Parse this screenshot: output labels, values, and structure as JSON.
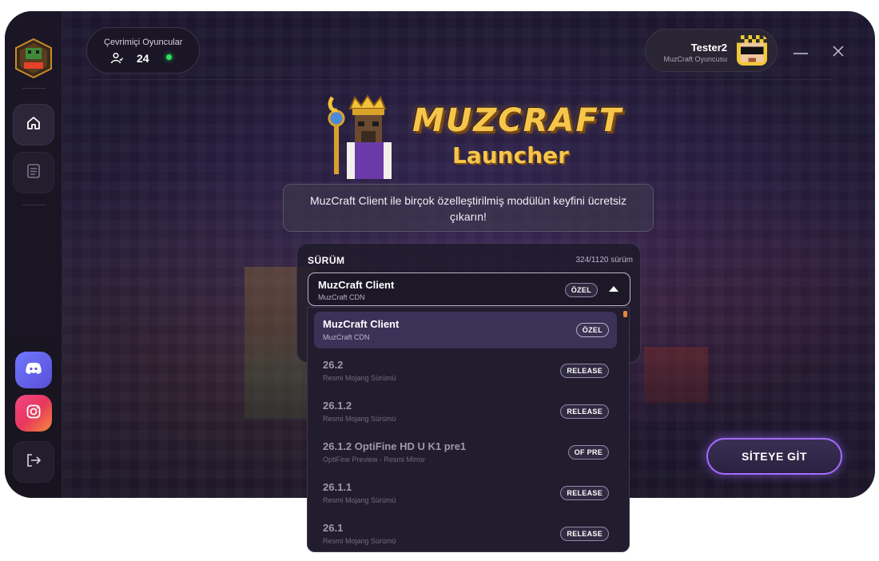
{
  "app": {
    "logo_text": "MUZCRAFT",
    "hero_title": "MUZCRAFT",
    "hero_subtitle": "Launcher"
  },
  "online": {
    "label": "Çevrimiçi Oyuncular",
    "count": "24",
    "status_color": "#2ee05a"
  },
  "user": {
    "name": "Tester2",
    "subtitle": "MuzCraft Oyuncusu"
  },
  "sidebar": {
    "items": [
      {
        "name": "home",
        "icon": "home-icon"
      },
      {
        "name": "news",
        "icon": "document-icon"
      },
      {
        "name": "discord",
        "icon": "discord-icon"
      },
      {
        "name": "instagram",
        "icon": "instagram-icon"
      },
      {
        "name": "logout",
        "icon": "logout-icon"
      }
    ]
  },
  "info": {
    "text": "MuzCraft Client ile birçok özelleştirilmiş modülün keyfini ücretsiz çıkarın!"
  },
  "version": {
    "label": "SÜRÜM",
    "count": "324/1120 sürüm",
    "selected": {
      "name": "MuzCraft Client",
      "source": "MuzCraft CDN",
      "badge": "ÖZEL"
    },
    "options": [
      {
        "name": "MuzCraft Client",
        "source": "MuzCraft CDN",
        "badge": "ÖZEL"
      },
      {
        "name": "26.2",
        "source": "Resmi Mojang Sürümü",
        "badge": "RELEASE"
      },
      {
        "name": "26.1.2",
        "source": "Resmi Mojang Sürümü",
        "badge": "RELEASE"
      },
      {
        "name": "26.1.2 OptiFine HD U K1 pre1",
        "source": "OptiFine Preview - Resmi Mirror",
        "badge": "OF PRE"
      },
      {
        "name": "26.1.1",
        "source": "Resmi Mojang Sürümü",
        "badge": "RELEASE"
      },
      {
        "name": "26.1",
        "source": "Resmi Mojang Sürümü",
        "badge": "RELEASE"
      }
    ]
  },
  "actions": {
    "site_button": "SİTEYE GİT"
  },
  "colors": {
    "accent": "#a26bff",
    "selected_row": "#3c3157",
    "title_gold": "#f6c64c"
  }
}
